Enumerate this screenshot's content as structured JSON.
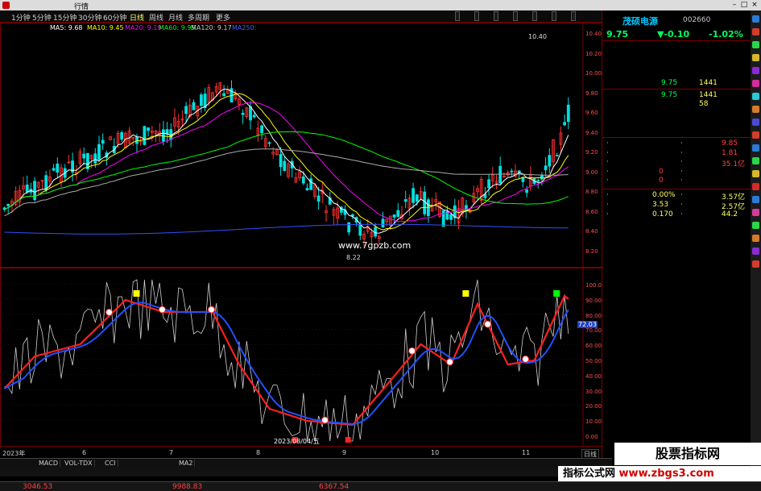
{
  "app": {
    "title": "",
    "menu": [
      "行情",
      "",
      "",
      "",
      "",
      "",
      "",
      ""
    ],
    "center_links": [
      "",
      ""
    ],
    "window_ctrl": [
      "",
      "",
      "",
      "",
      ""
    ]
  },
  "toolbar": {
    "periods": [
      "1分钟",
      "5分钟",
      "15分钟",
      "30分钟",
      "60分钟",
      "日线",
      "周线",
      "月线",
      "多周期",
      "更多"
    ],
    "buttons": [
      "",
      "",
      "",
      "",
      "",
      "",
      ""
    ]
  },
  "stock": {
    "name": "茂硕电源",
    "code": "002660",
    "price": "9.75",
    "change": "▼-0.10",
    "pct": "-1.02%",
    "chart_tag": ""
  },
  "ma_legend": [
    {
      "label": "MA5: 9.68",
      "color": "#ffffff"
    },
    {
      "label": "MA10: 9.45",
      "color": "#ffff00"
    },
    {
      "label": "MA20: 9.19",
      "color": "#ff00ff"
    },
    {
      "label": "MA60: 9.95",
      "color": "#00ff00"
    },
    {
      "label": "MA120: 9.17",
      "color": "#c8c8c8"
    },
    {
      "label": "MA250:",
      "color": "#4060ff"
    }
  ],
  "price_axis": [
    "10.40",
    "10.20",
    "10.00",
    "9.80",
    "9.60",
    "9.40",
    "9.20",
    "9.00",
    "8.80",
    "8.60",
    "8.40",
    "8.20"
  ],
  "annotations": {
    "high": "10.40",
    "low": "8.22",
    "watermark_url": "www.7gpzb.com",
    "date_tag": "2023/08/04/五"
  },
  "indicator_legend": [
    {
      "label": "",
      "color": "#c8c8c8"
    },
    {
      "label": "",
      "color": "#ff3030"
    },
    {
      "label": "",
      "color": "#4060ff"
    },
    {
      "label": "",
      "color": "#ffff00"
    },
    {
      "label": "",
      "color": "#00ff00"
    },
    {
      "label": "",
      "color": "#ff3030"
    },
    {
      "label": "",
      "color": "#4060ff"
    },
    {
      "label": "",
      "color": "#ffffff"
    }
  ],
  "ind_axis": [
    "100.0",
    "90.00",
    "80.00",
    "70.00",
    "60.00",
    "50.00",
    "40.00",
    "30.00",
    "20.00",
    "10.00",
    "0.00"
  ],
  "ind_value_tag": "72.03",
  "x_axis": [
    "2023年",
    "6",
    "7",
    "8",
    "9",
    "10",
    "11"
  ],
  "orderbook": {
    "sell": [
      {
        "label": "",
        "price": "",
        "vol": ""
      },
      {
        "label": "",
        "price": "",
        "vol": ""
      },
      {
        "label": "",
        "price": "",
        "vol": ""
      },
      {
        "label": "",
        "price": "",
        "vol": ""
      },
      {
        "label": "",
        "price": "9.75",
        "vol": "1441"
      }
    ],
    "buy": [
      {
        "label": "",
        "price": "9.75",
        "vol": "1441"
      },
      {
        "label": "",
        "price": "",
        "vol": "58"
      },
      {
        "label": "",
        "price": "",
        "vol": ""
      },
      {
        "label": "",
        "price": "",
        "vol": ""
      },
      {
        "label": "",
        "price": "",
        "vol": ""
      }
    ]
  },
  "stats": [
    {
      "k1": "·",
      "v1": "",
      "k2": "·",
      "v2": "9.85"
    },
    {
      "k1": "·",
      "v1": "",
      "k2": "·",
      "v2": "1.81"
    },
    {
      "k1": "·",
      "v1": "",
      "k2": "·",
      "v2": "35.1亿"
    },
    {
      "k1": "·",
      "v1": "0",
      "k2": "·",
      "v2": ""
    },
    {
      "k1": "·",
      "v1": "0",
      "k2": "·",
      "v2": ""
    }
  ],
  "stats2": [
    {
      "k1": "·",
      "v1": "0.00%",
      "k2": "·",
      "v2": "3.57亿"
    },
    {
      "k1": "·",
      "v1": "3.53",
      "k2": "·",
      "v2": "2.57亿"
    },
    {
      "k1": "·",
      "v1": "0.170",
      "k2": "·",
      "v2": "44.2"
    }
  ],
  "bottom_tabs": [
    "",
    "",
    "MACD",
    "VOL-TDX",
    "CCI",
    "",
    "",
    "",
    "MA2",
    "",
    "",
    "",
    "",
    "",
    ""
  ],
  "status_tabs": [
    "",
    "",
    "",
    "",
    "",
    "",
    "",
    ""
  ],
  "index_bar": [
    {
      "name": "",
      "value": "3046.53",
      "color": "#ff4040"
    },
    {
      "name": "",
      "value": "9988.83",
      "color": "#ff4040"
    },
    {
      "name": "",
      "value": "6367.54",
      "color": "#ff4040"
    }
  ],
  "broker": "",
  "watermarks": {
    "top": "股票指标网",
    "bottom": "指标公式网",
    "url": "www.zbgs3.com"
  }
}
